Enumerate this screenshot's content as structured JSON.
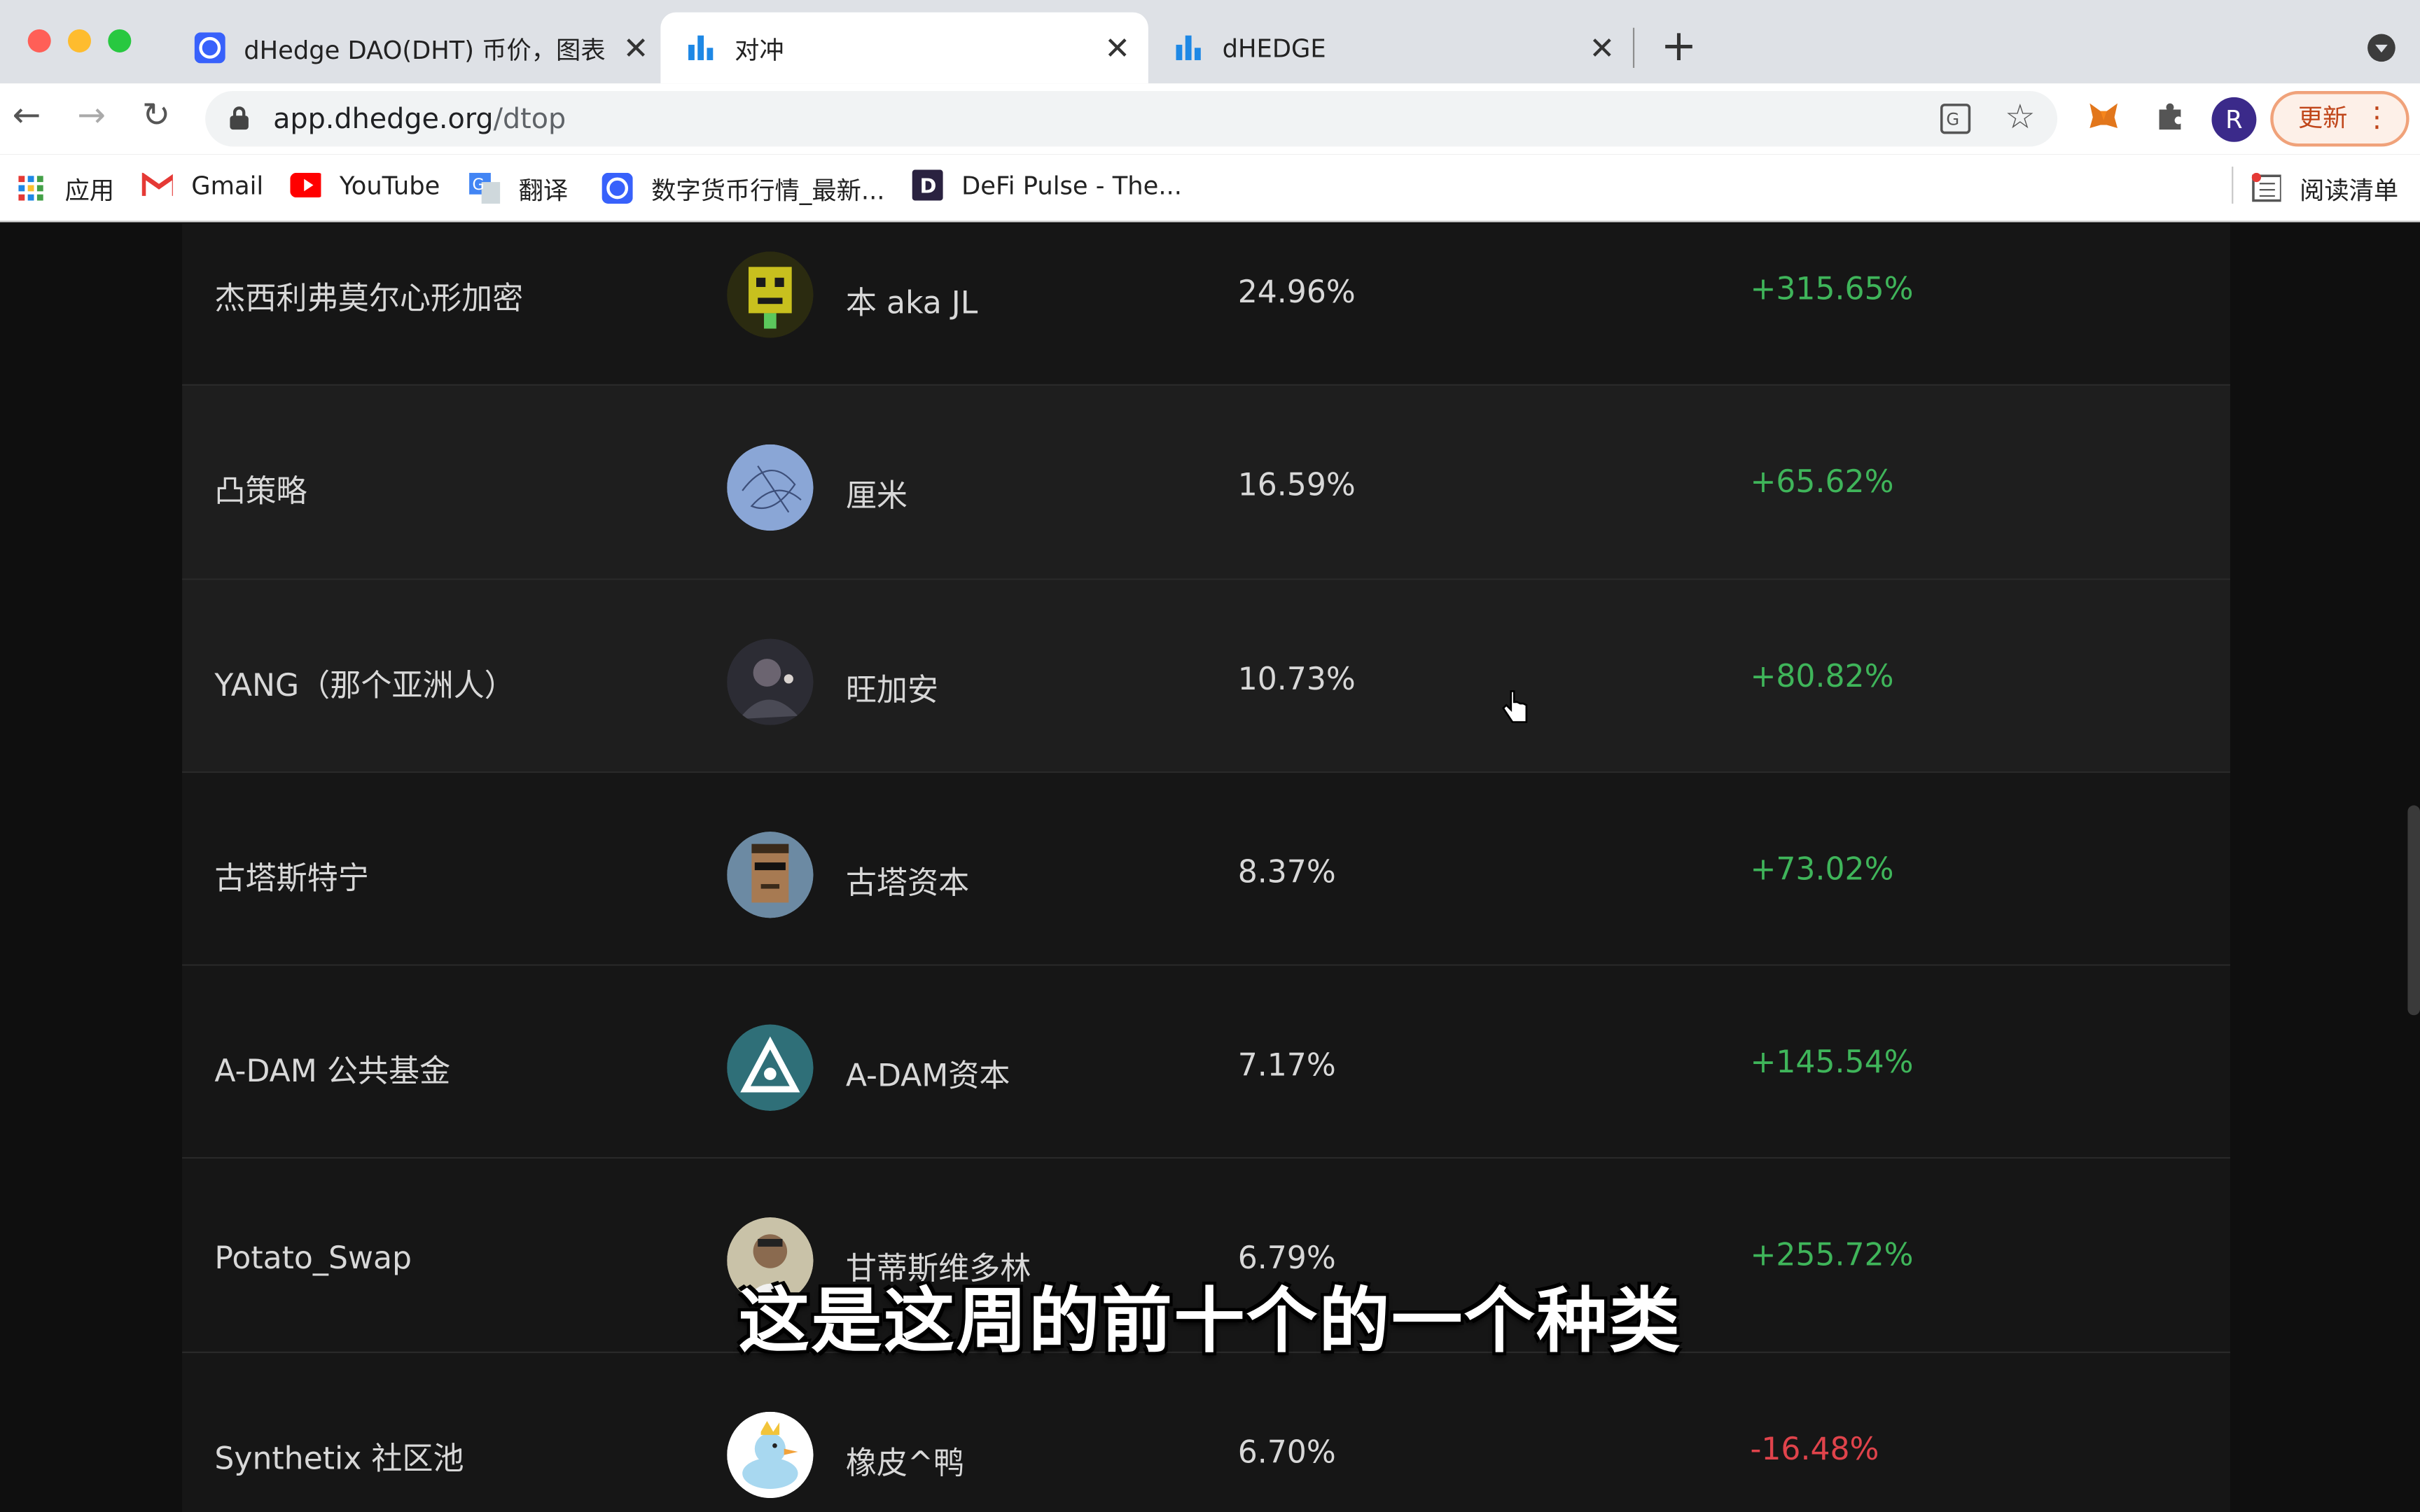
{
  "browser": {
    "tabs": [
      {
        "title": "dHedge DAO(DHT) 币价，图表",
        "icon": "coinmarketcap-icon",
        "active": false
      },
      {
        "title": "对冲",
        "icon": "dhedge-bars-icon",
        "active": true
      },
      {
        "title": "dHEDGE",
        "icon": "dhedge-bars-icon",
        "active": false
      }
    ],
    "url_host": "app.dhedge.org",
    "url_path": "/dtop",
    "profile_initial": "R",
    "update_label": "更新",
    "bookmarks": [
      {
        "label": "应用",
        "icon": "apps-grid-icon"
      },
      {
        "label": "Gmail",
        "icon": "gmail-icon"
      },
      {
        "label": "YouTube",
        "icon": "youtube-icon"
      },
      {
        "label": "翻译",
        "icon": "translate-icon"
      },
      {
        "label": "数字货币行情_最新...",
        "icon": "coinmarketcap-icon"
      },
      {
        "label": "DeFi Pulse - The...",
        "icon": "defi-pulse-icon"
      }
    ],
    "reading_list_label": "阅读清单"
  },
  "leaderboard": {
    "rows": [
      {
        "pool": "杰西利弗莫尔心形加密",
        "manager": "本 aka JL",
        "share": "24.96%",
        "return": "+315.65%",
        "trend": "up",
        "avatar": "pixel-punk-avatar"
      },
      {
        "pool": "凸策略",
        "manager": "厘米",
        "share": "16.59%",
        "return": "+65.62%",
        "trend": "up",
        "avatar": "blue-sketch-avatar"
      },
      {
        "pool": "YANG（那个亚洲人）",
        "manager": "旺加安",
        "share": "10.73%",
        "return": "+80.82%",
        "trend": "up",
        "avatar": "portrait-avatar"
      },
      {
        "pool": "古塔斯特宁",
        "manager": "古塔资本",
        "share": "8.37%",
        "return": "+73.02%",
        "trend": "up",
        "avatar": "cryptopunk-avatar"
      },
      {
        "pool": "A-DAM 公共基金",
        "manager": "A-DAM资本",
        "share": "7.17%",
        "return": "+145.54%",
        "trend": "up",
        "avatar": "a-dam-logo-avatar"
      },
      {
        "pool": "Potato_Swap",
        "manager": "甘蒂斯维多林",
        "share": "6.79%",
        "return": "+255.72%",
        "trend": "up",
        "avatar": "photo-avatar"
      },
      {
        "pool": "Synthetix 社区池",
        "manager": "橡皮^鸭",
        "share": "6.70%",
        "return": "-16.48%",
        "trend": "down",
        "avatar": "rubber-duck-avatar"
      }
    ]
  },
  "subtitle": "这是这周的前十个的一个种类",
  "colors": {
    "positive": "#3fb55a",
    "negative": "#e0434b",
    "background": "#0f0f0f"
  }
}
